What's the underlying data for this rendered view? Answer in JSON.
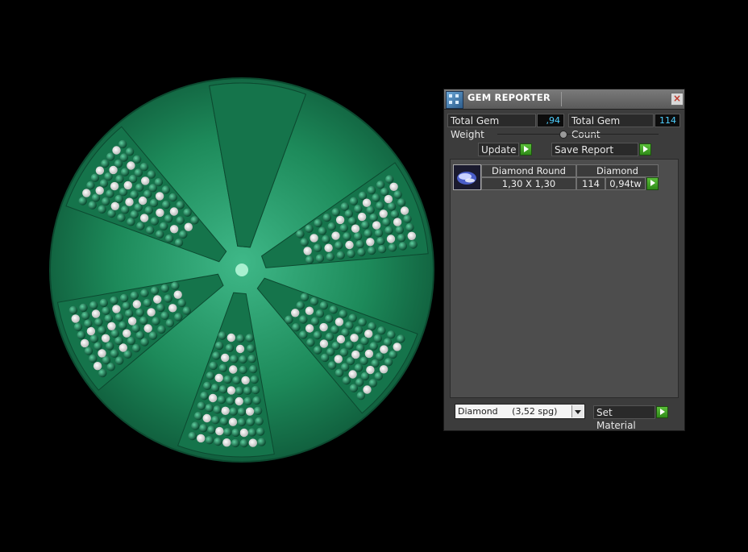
{
  "panel": {
    "title": "GEM REPORTER",
    "close_icon": "close-icon",
    "app_icon": "gem-reporter-app-icon"
  },
  "stats": {
    "total_weight_label": "Total Gem Weight",
    "total_weight_value": ",94",
    "total_count_label": "Total Gem Count",
    "total_count_value": "114"
  },
  "actions": {
    "update_label": "Update",
    "save_report_label": "Save Report"
  },
  "gem_rows": [
    {
      "icon": "gem-thumbnail-icon",
      "cut": "Diamond Round",
      "material": "Diamond",
      "size": "1,30 X 1,30",
      "count": "114",
      "weight": "0,94tw"
    }
  ],
  "material_select": {
    "selected": "Diamond     (3,52 spg)"
  },
  "set_material_label": "Set Material",
  "colors": {
    "gem_green": "#1f8a5c",
    "panel_bg": "#3c3c3c",
    "value_text": "#4fd0ff",
    "arrow_green": "#3aa821"
  }
}
